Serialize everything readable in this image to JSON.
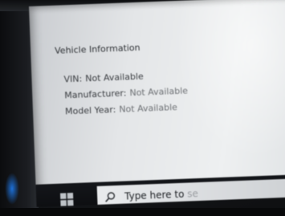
{
  "panel": {
    "title": "Vehicle Information",
    "rows": [
      {
        "label": "VIN:",
        "value": "Not Available"
      },
      {
        "label": "Manufacturer:",
        "value": "Not Available"
      },
      {
        "label": "Model Year:",
        "value": "Not Available"
      }
    ]
  },
  "taskbar": {
    "start_icon": "windows-logo-icon",
    "search_icon": "search-icon",
    "search_placeholder_visible": "Type here to",
    "search_placeholder_fade": "se"
  },
  "colors": {
    "taskbar_bg": "#0c0d10",
    "screen_bg": "#e4e6e8",
    "windows_blue": "#1d6fd6"
  }
}
